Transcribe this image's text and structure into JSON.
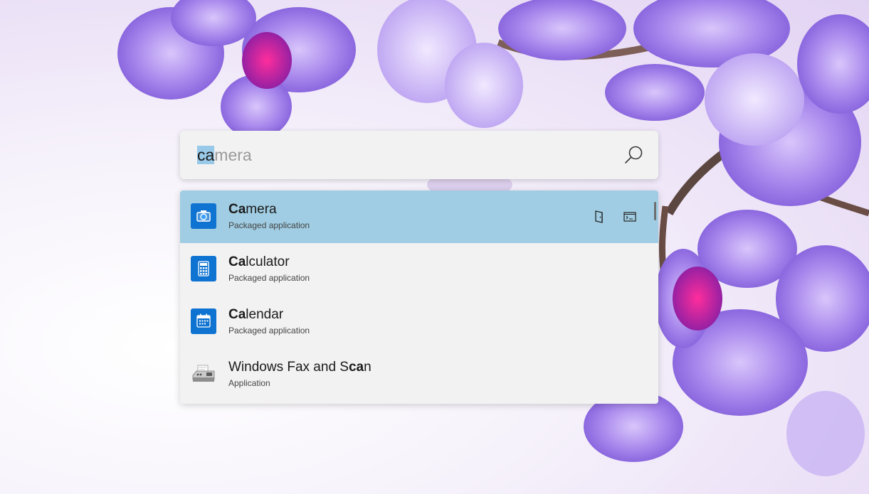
{
  "search": {
    "typed_text": "ca",
    "suggestion_text": "mera"
  },
  "results": [
    {
      "title_match": "Ca",
      "title_rest": "mera",
      "title_prefix": "",
      "subtitle": "Packaged application",
      "icon": "camera-icon",
      "selected": true
    },
    {
      "title_match": "Ca",
      "title_rest": "lculator",
      "title_prefix": "",
      "subtitle": "Packaged application",
      "icon": "calculator-icon",
      "selected": false
    },
    {
      "title_match": "Ca",
      "title_rest": "lendar",
      "title_prefix": "",
      "subtitle": "Packaged application",
      "icon": "calendar-icon",
      "selected": false
    },
    {
      "title_prefix": "Windows Fax and S",
      "title_match": "ca",
      "title_rest": "n",
      "subtitle": "Application",
      "icon": "fax-scanner-icon",
      "selected": false
    }
  ],
  "colors": {
    "selected_row": "#a0cde3",
    "text_highlight": "#99c9e8",
    "app_tile": "#0f73d1"
  }
}
